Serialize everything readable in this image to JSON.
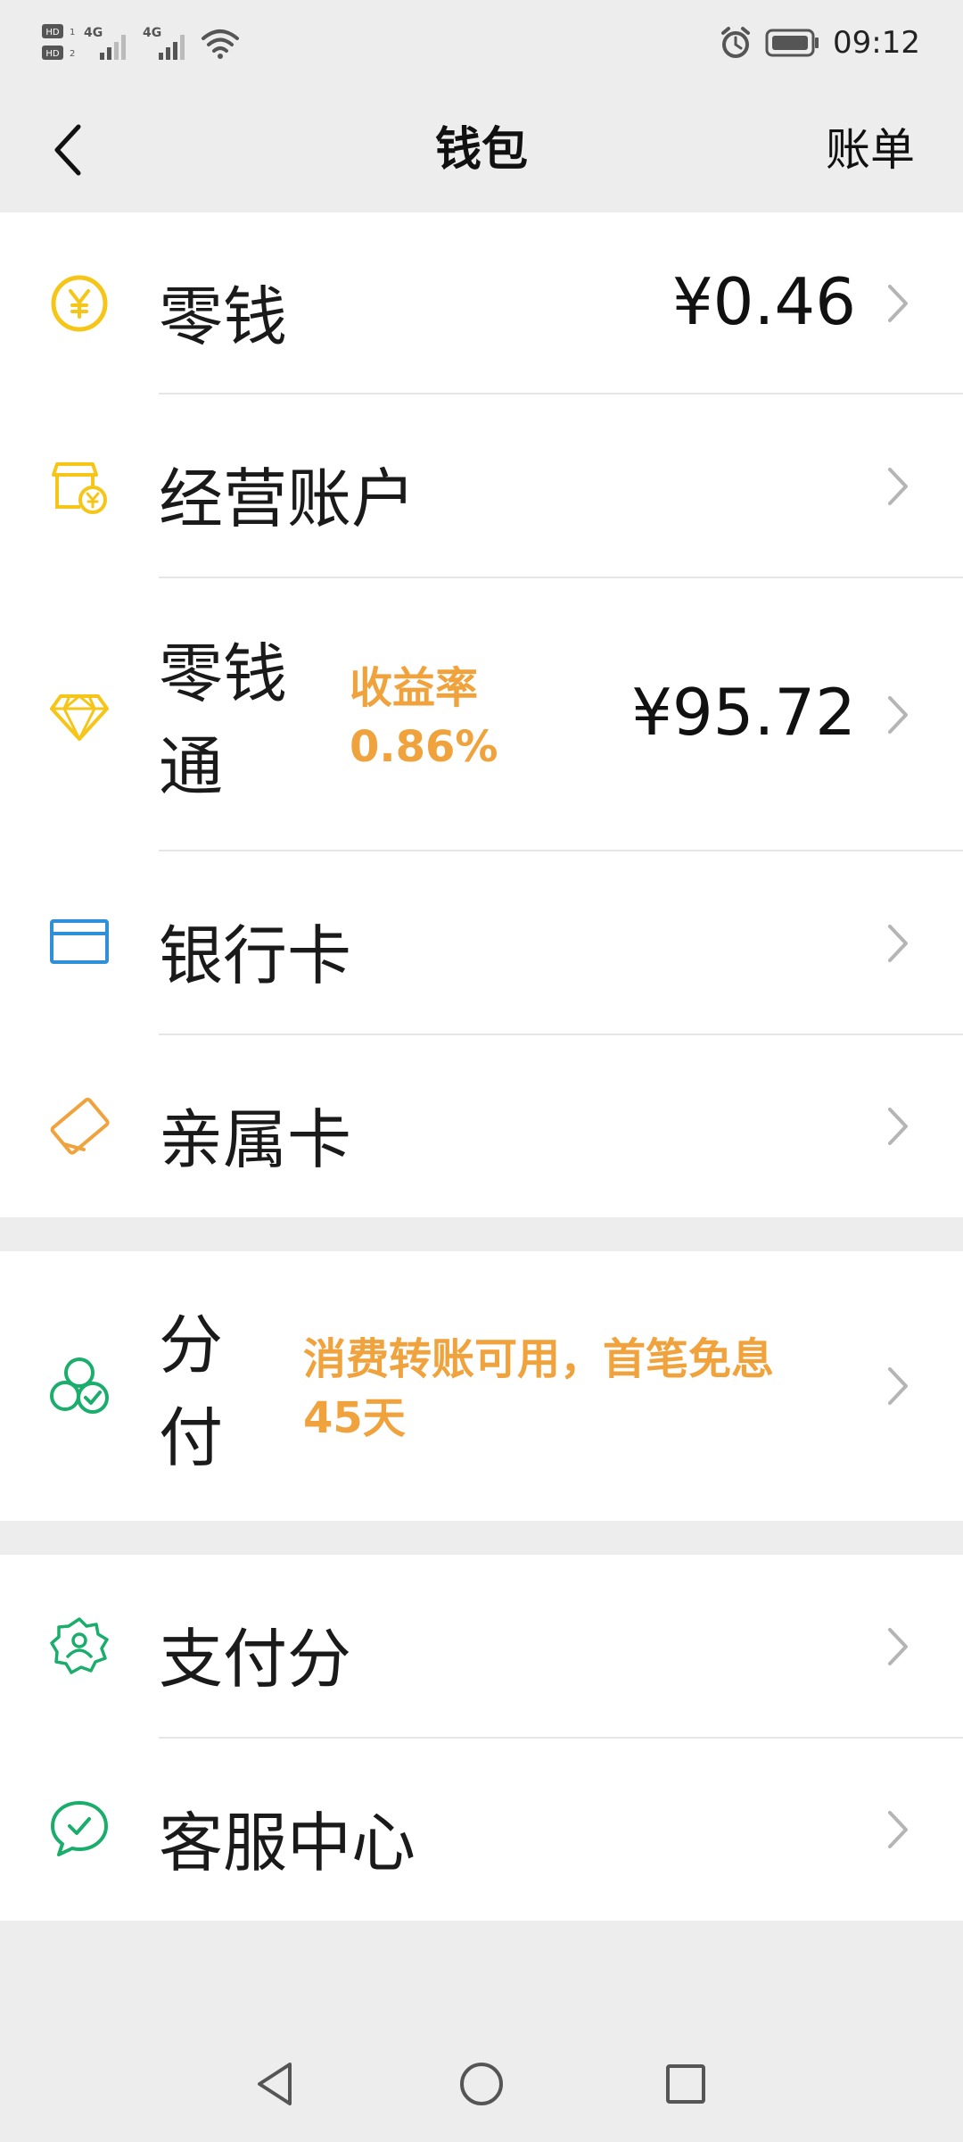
{
  "status_bar": {
    "time": "09:12",
    "hd1": "HD1",
    "hd2": "HD2",
    "net1": "4G",
    "net2": "4G"
  },
  "nav": {
    "title": "钱包",
    "right_label": "账单"
  },
  "group1": {
    "items": [
      {
        "label": "零钱",
        "value": "¥0.46",
        "icon": "yuan-coin-icon"
      },
      {
        "label": "经营账户",
        "value": "",
        "icon": "shop-account-icon"
      },
      {
        "label_line1": "零钱",
        "label_line2": "通",
        "tag_line1": "收益率",
        "tag_line2": "0.86%",
        "value": "¥95.72",
        "icon": "diamond-icon"
      },
      {
        "label": "银行卡",
        "value": "",
        "icon": "bank-card-icon"
      },
      {
        "label": "亲属卡",
        "value": "",
        "icon": "family-card-icon"
      }
    ]
  },
  "group2": {
    "item": {
      "label_line1": "分",
      "label_line2": "付",
      "tag_line1": "消费转账可用，首笔免息",
      "tag_line2": "45天",
      "icon": "fenfu-icon"
    }
  },
  "group3": {
    "items": [
      {
        "label": "支付分",
        "icon": "pay-score-icon"
      },
      {
        "label": "客服中心",
        "icon": "customer-service-icon"
      }
    ]
  },
  "colors": {
    "accent_yellow": "#f5c518",
    "accent_orange": "#f0a23c",
    "accent_blue": "#2f8fd8",
    "accent_green": "#1aad6b",
    "background": "#ededed"
  }
}
